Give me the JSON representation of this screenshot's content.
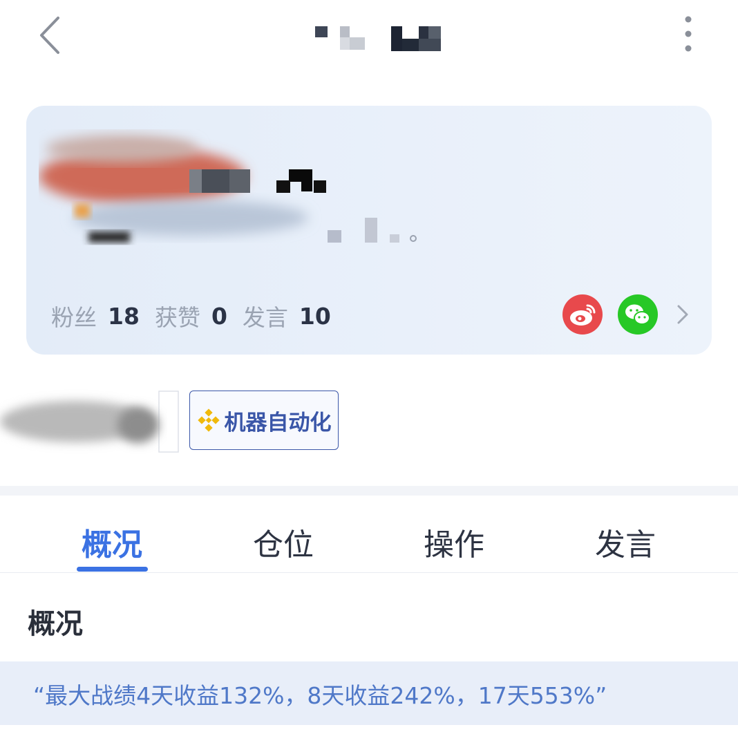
{
  "nav": {
    "back_icon": "chevron-left-icon",
    "more_icon": "more-vertical-icon"
  },
  "profile": {
    "stats": {
      "followers_label": "粉丝",
      "followers_value": "18",
      "likes_label": "获赞",
      "likes_value": "0",
      "posts_label": "发言",
      "posts_value": "10"
    },
    "social": {
      "weibo_icon": "weibo-icon",
      "wechat_icon": "wechat-icon",
      "weibo_color": "#e8494c",
      "wechat_color": "#27c826"
    }
  },
  "tags": {
    "robot_label": "机器自动化",
    "robot_icon": "binance-diamond-icon",
    "robot_color": "#3a56a8"
  },
  "tabs": [
    {
      "label": "概况",
      "active": true
    },
    {
      "label": "仓位",
      "active": false
    },
    {
      "label": "操作",
      "active": false
    },
    {
      "label": "发言",
      "active": false
    }
  ],
  "overview": {
    "title": "概况",
    "quote": "“最大战绩4天收益132%，8天收益242%，17天553%”"
  },
  "colors": {
    "accent": "#3b72e3",
    "card_bg": "#e6eef9",
    "quote_bg": "#e8eef9",
    "quote_text": "#4f78c8"
  }
}
